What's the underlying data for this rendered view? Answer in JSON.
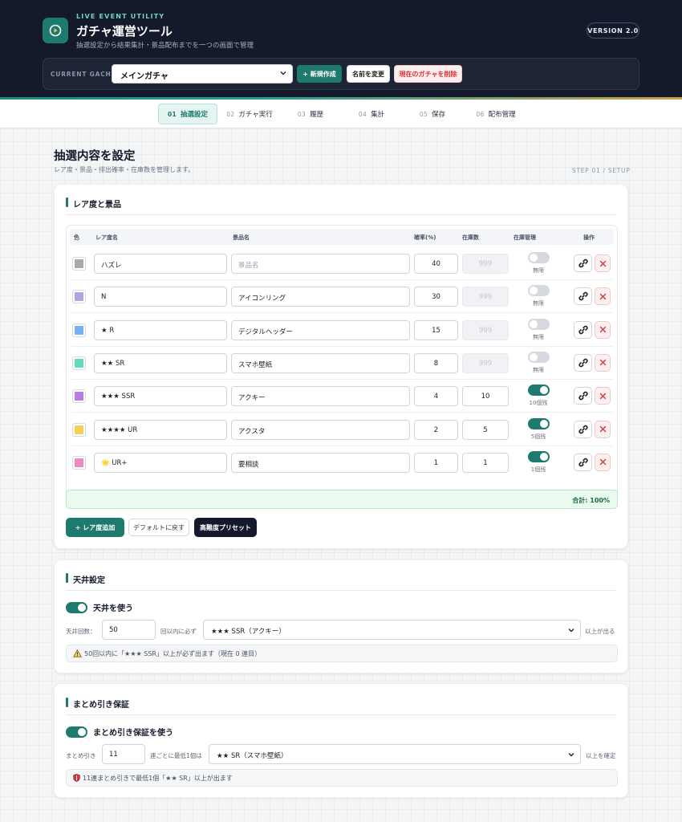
{
  "header": {
    "eyebrow": "LIVE EVENT UTILITY",
    "title": "ガチャ運営ツール",
    "subtitle": "抽選設定から結果集計・景品配布までを一つの画面で管理",
    "version": "VERSION 2.0",
    "current_gacha_label": "CURRENT GACHA",
    "current_gacha_value": "メインガチャ",
    "new_button": "+ 新規作成",
    "rename_button": "名前を変更",
    "delete_button": "現在のガチャを削除"
  },
  "steps": [
    {
      "num": "01",
      "label": "抽選設定",
      "active": true
    },
    {
      "num": "02",
      "label": "ガチャ実行",
      "active": false
    },
    {
      "num": "03",
      "label": "履歴",
      "active": false
    },
    {
      "num": "04",
      "label": "集計",
      "active": false
    },
    {
      "num": "05",
      "label": "保存",
      "active": false
    },
    {
      "num": "06",
      "label": "配布管理",
      "active": false
    }
  ],
  "page": {
    "title": "抽選内容を設定",
    "description": "レア度・景品・排出確率・在庫数を管理します。",
    "step_tag": "STEP 01 / SETUP"
  },
  "rarity_card": {
    "title": "レア度と景品",
    "headers": {
      "color": "色",
      "rarity": "レア度名",
      "prize": "景品名",
      "rate": "確率(%)",
      "stock": "在庫数",
      "stock_manage": "在庫管理",
      "actions": "操作"
    },
    "prize_placeholder": "景品名",
    "stock_placeholder": "999",
    "rows": [
      {
        "color": "#a7a9ad",
        "rarity": "ハズレ",
        "prize": "",
        "rate": "40",
        "stock": "",
        "managed": false,
        "stock_label": "無限"
      },
      {
        "color": "#aaa7e3",
        "rarity": "N",
        "prize": "アイコンリング",
        "rate": "30",
        "stock": "",
        "managed": false,
        "stock_label": "無限"
      },
      {
        "color": "#74b3f2",
        "rarity": "★ R",
        "prize": "デジタルヘッダー",
        "rate": "15",
        "stock": "",
        "managed": false,
        "stock_label": "無限"
      },
      {
        "color": "#61dcbd",
        "rarity": "★★ SR",
        "prize": "スマホ壁紙",
        "rate": "8",
        "stock": "",
        "managed": false,
        "stock_label": "無限"
      },
      {
        "color": "#b57cea",
        "rarity": "★★★ SSR",
        "prize": "アクキー",
        "rate": "4",
        "stock": "10",
        "managed": true,
        "stock_label": "10個残"
      },
      {
        "color": "#f6ce55",
        "rarity": "★★★★ UR",
        "prize": "アクスタ",
        "rate": "2",
        "stock": "5",
        "managed": true,
        "stock_label": "5個残"
      },
      {
        "color": "#ee88c3",
        "rarity": "🌟 UR+",
        "prize": "要相談",
        "rate": "1",
        "stock": "1",
        "managed": true,
        "stock_label": "1個残"
      }
    ],
    "total": "合計: 100%",
    "add_button": "+ レア度追加",
    "reset_button": "デフォルトに戻す",
    "preset_button": "高難度プリセット"
  },
  "ceiling_card": {
    "title": "天井設定",
    "toggle_label": "天井を使う",
    "enabled": true,
    "count_label": "天井回数：",
    "count_value": "50",
    "mid_label": "回以内に必ず",
    "select_value": "★★★ SSR（アクキー）",
    "suffix": "以上が出る",
    "info": "50回以内に「★★★ SSR」以上が必ず出ます（現在 0 連目）"
  },
  "bundle_card": {
    "title": "まとめ引き保証",
    "toggle_label": "まとめ引き保証を使う",
    "enabled": true,
    "count_label": "まとめ引き",
    "count_value": "11",
    "mid_label": "連ごとに最低1個は",
    "select_value": "★★ SR（スマホ壁紙）",
    "suffix": "以上を確定",
    "info": "11連まとめ引きで最低1個「★★ SR」以上が出ます"
  },
  "colors": {
    "brand": "#1e7a6e",
    "header_bg": "#141a2b",
    "danger": "#d93434"
  },
  "icons": [
    "clock-play-icon",
    "chevron-down-icon",
    "link-icon",
    "close-icon",
    "warning-icon",
    "shield-icon"
  ]
}
